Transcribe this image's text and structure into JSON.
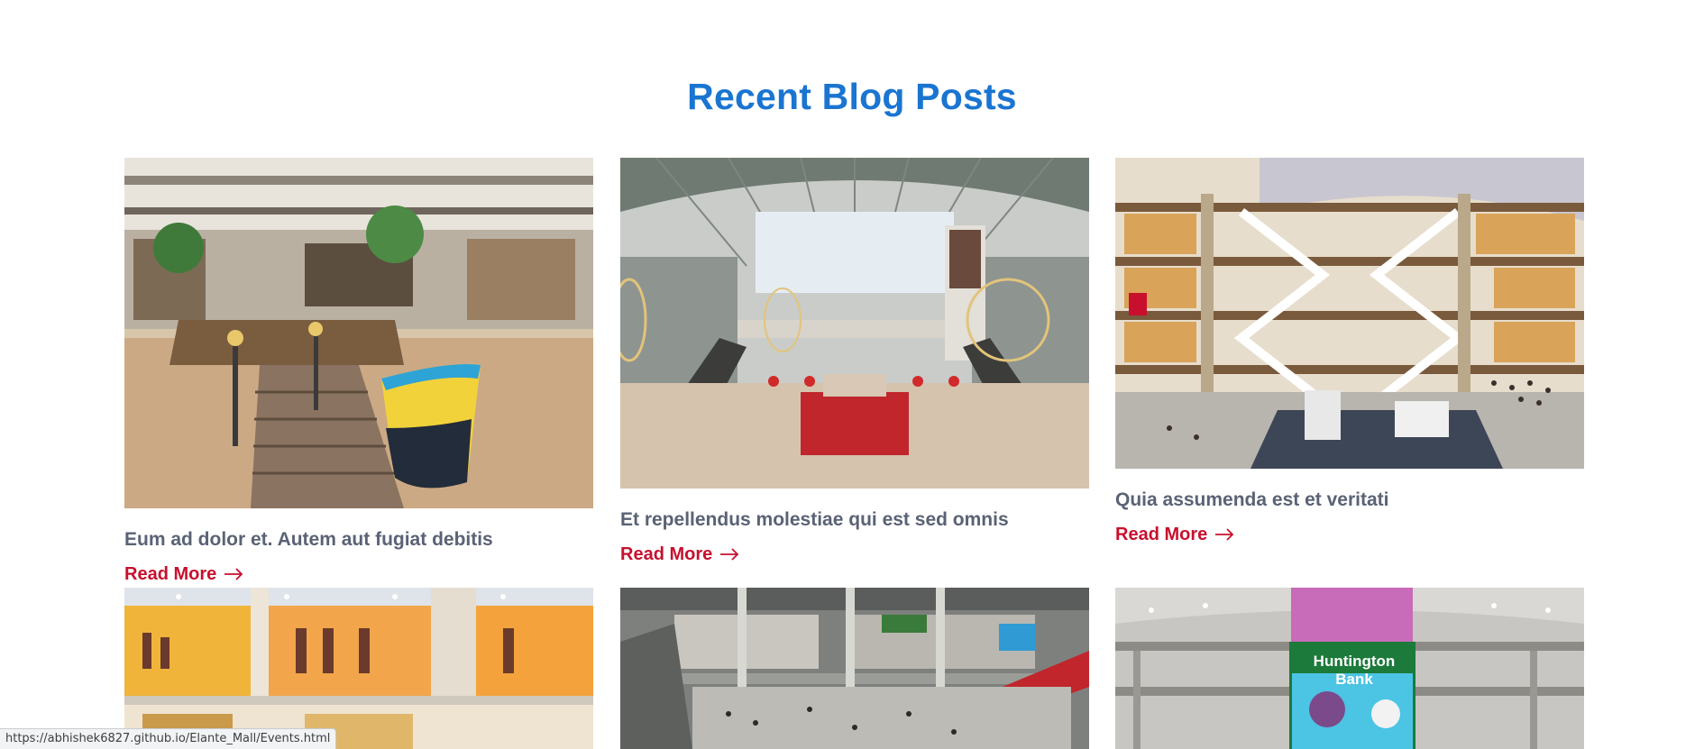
{
  "section": {
    "title": "Recent Blog Posts"
  },
  "posts": [
    {
      "title": "Eum ad dolor et. Autem aut fugiat debitis",
      "read_more": "Read More",
      "image": "mall-atrium-with-boat-display"
    },
    {
      "title": "Et repellendus molestiae qui est sed omnis",
      "read_more": "Read More",
      "image": "mall-hall-with-glass-roof-and-escalators"
    },
    {
      "title": "Quia assumenda est et veritati",
      "read_more": "Read More",
      "image": "multi-level-mall-with-criss-cross-escalators"
    },
    {
      "image": "mall-storefronts-with-pillars"
    },
    {
      "image": "mall-interior-with-red-banner"
    },
    {
      "image": "mall-with-huntington-bank-screen",
      "sign_text": "Huntington Bank"
    }
  ],
  "status_bar": {
    "url": "https://abhishek6827.github.io/Elante_Mall/Events.html"
  },
  "colors": {
    "heading": "#1a75d1",
    "post_title": "#5a6275",
    "read_more": "#c8102e"
  }
}
